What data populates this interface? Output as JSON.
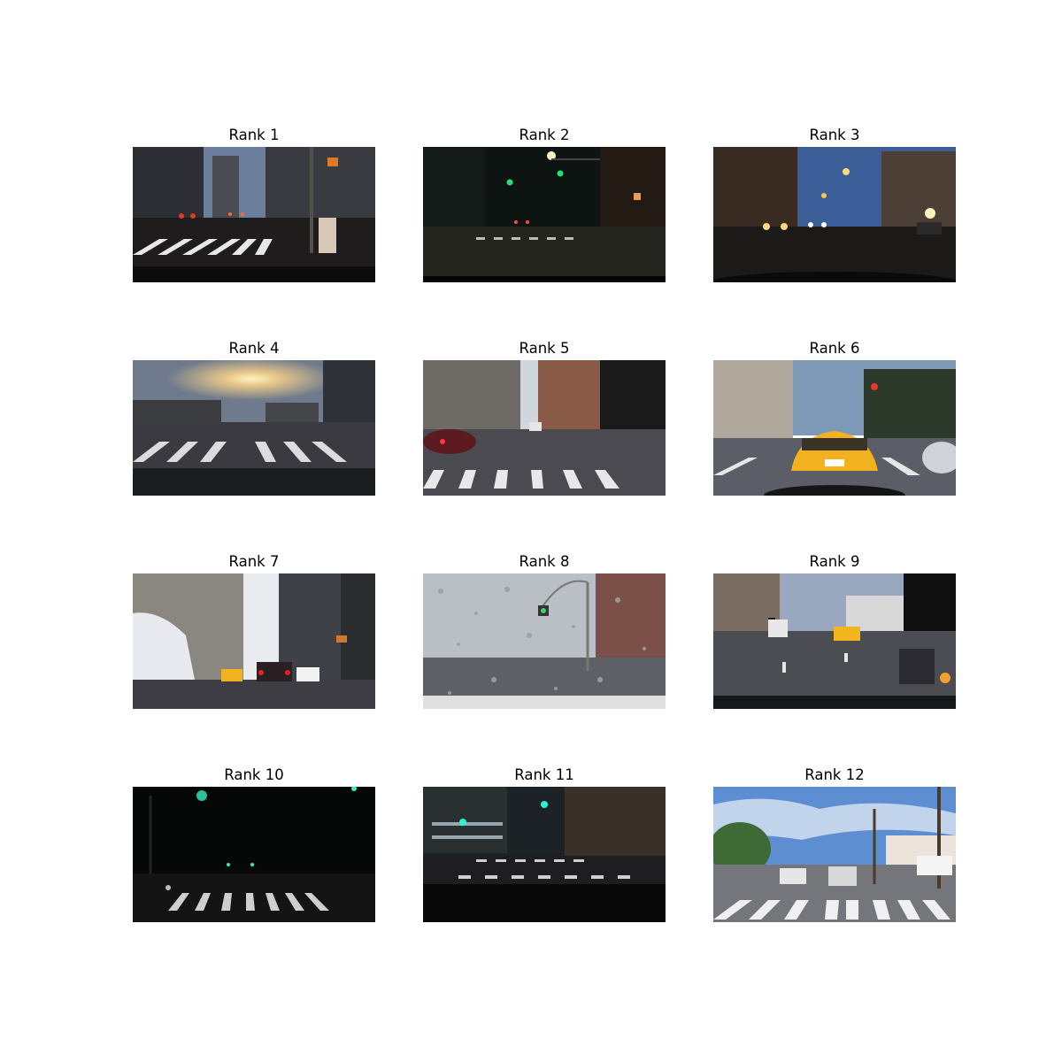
{
  "grid": {
    "items": [
      {
        "title": "Rank 1",
        "scene": "dusk-crosswalk",
        "sky": "#6b7f9c",
        "ground": "#1e1c1c",
        "accent": "#e23a22"
      },
      {
        "title": "Rank 2",
        "scene": "night-green-lights",
        "sky": "#0e1412",
        "ground": "#24251f",
        "accent": "#22e07a"
      },
      {
        "title": "Rank 3",
        "scene": "evening-avenue",
        "sky": "#3b5e99",
        "ground": "#1b1a18",
        "accent": "#f5c94b"
      },
      {
        "title": "Rank 4",
        "scene": "sunset-crosswalk",
        "sky": "#6f7a8c",
        "ground": "#3a3a40",
        "accent": "#ffe9a8"
      },
      {
        "title": "Rank 5",
        "scene": "wet-street",
        "sky": "#cfd6dc",
        "ground": "#4a4a50",
        "accent": "#b41e2a"
      },
      {
        "title": "Rank 6",
        "scene": "yellow-taxi",
        "sky": "#7e99b8",
        "ground": "#5b5e66",
        "accent": "#f2b21e"
      },
      {
        "title": "Rank 7",
        "scene": "midtown-canyon",
        "sky": "#e9ecef",
        "ground": "#3e3d44",
        "accent": "#e5202b"
      },
      {
        "title": "Rank 8",
        "scene": "rainy-windshield",
        "sky": "#b9bfc4",
        "ground": "#5d6064",
        "accent": "#3fd06e"
      },
      {
        "title": "Rank 9",
        "scene": "boulevard-traffic",
        "sky": "#9aa8bf",
        "ground": "#4c4d53",
        "accent": "#f1b51d"
      },
      {
        "title": "Rank 10",
        "scene": "dark-night-crosswalk",
        "sky": "#060807",
        "ground": "#141414",
        "accent": "#2ff0c0"
      },
      {
        "title": "Rank 11",
        "scene": "night-city-crosswalk",
        "sky": "#1c2226",
        "ground": "#1e1e20",
        "accent": "#2af5d2"
      },
      {
        "title": "Rank 12",
        "scene": "sunny-suburb",
        "sky": "#5c8ed1",
        "ground": "#75767b",
        "accent": "#ffffff"
      }
    ]
  }
}
